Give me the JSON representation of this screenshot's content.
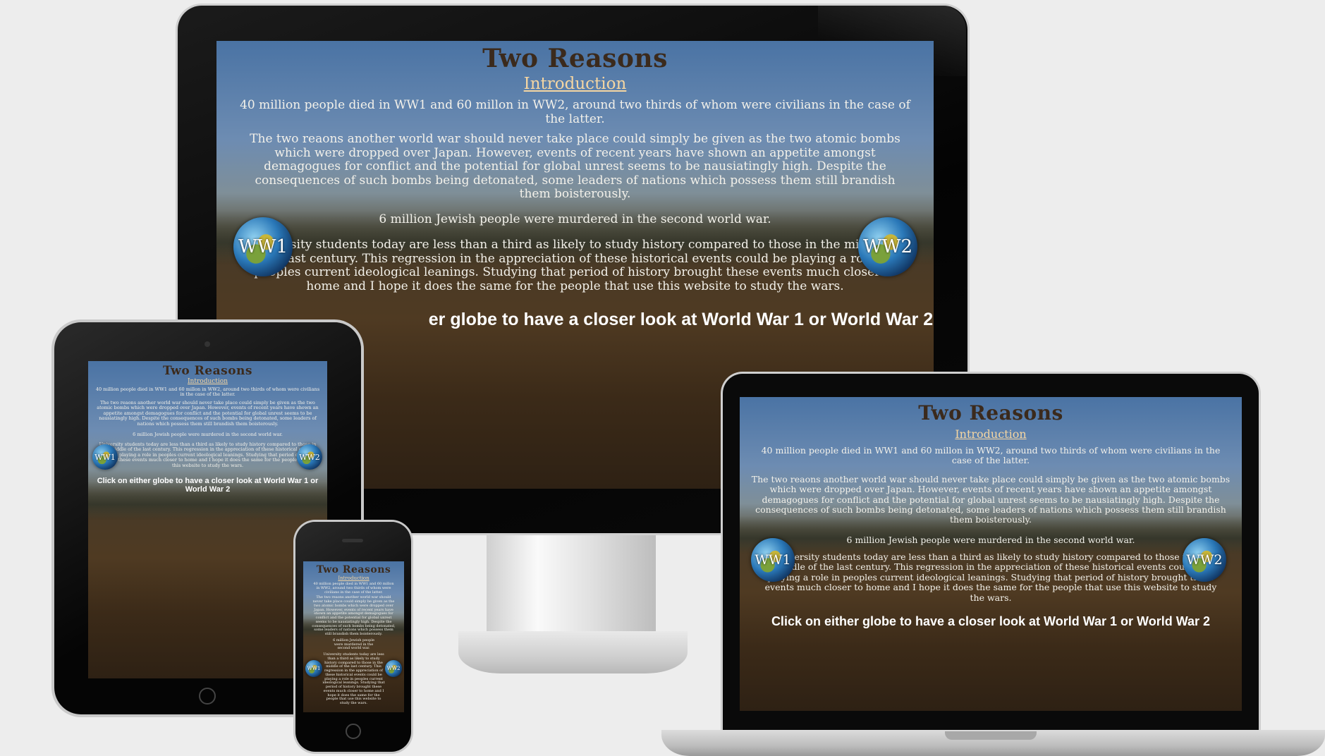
{
  "site": {
    "title": "Two Reasons",
    "intro_heading": "Introduction",
    "p1": "40 million people died in WW1 and 60 millon in WW2, around two thirds of whom were civilians in the case of the latter.",
    "p2": "The two reaons another world war should never take place could simply be given as the two atomic bombs which were dropped over Japan. However, events of recent years have shown an appetite amongst demagogues for conflict and the potential for global unrest seems to be nausiatingly high. Despite the consequences of such bombs being detonated, some leaders of nations which possess them still brandish them boisterously.",
    "p3": "6 million Jewish people were murdered in the second world war.",
    "p4": "University students today are less than a third as likely to study history compared to those in the middle of the last century. This regression in the appreciation of these historical events could be playing a role in peoples current ideological leanings. Studying that period of history brought these events much closer to home and I hope it does the same for the people that use this website to study the wars.",
    "cta": "Click on either globe to have a closer look at World War 1 or World War 2",
    "cta_monitor_visible": "er globe to have a closer look at World War 1 or World War 2",
    "globe_left": "WW1",
    "globe_right": "WW2"
  },
  "colors": {
    "page_bg": "#ededed",
    "title": "#3b2a1c",
    "intro": "#f5d6a2",
    "text": "#f3f1ea"
  }
}
